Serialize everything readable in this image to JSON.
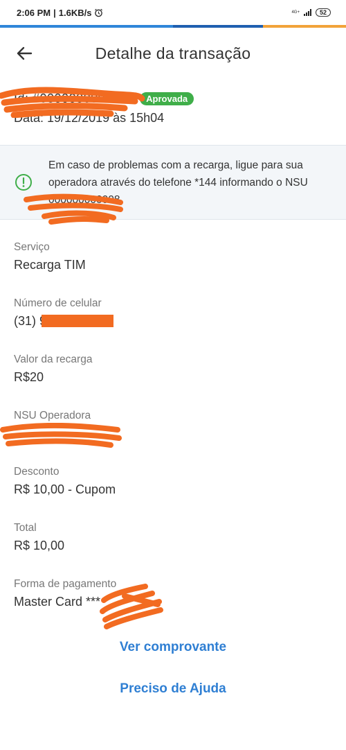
{
  "status_bar": {
    "time": "2:06 PM",
    "speed": "1.6KB/s",
    "alarm_icon": "alarm-clock-icon",
    "network_type": "4G+",
    "battery": "52"
  },
  "header": {
    "back_icon": "arrow-left-icon",
    "title": "Detalhe da transação"
  },
  "transaction": {
    "id": "Id: #0000000000702",
    "status": "Aprovada",
    "status_color": "#3fae49",
    "date": "Data: 19/12/2019 às 15h04"
  },
  "alert": {
    "icon": "exclamation-circle-icon",
    "icon_color": "#3fae49",
    "line1": "Em caso de problemas com a recarga, ligue para sua",
    "line2": "operadora através do telefone *144 informando o NSU",
    "line3": "000000000008"
  },
  "fields": [
    {
      "label": "Serviço",
      "value": "Recarga TIM"
    },
    {
      "label": "Número de celular",
      "value": "(31) 99"
    },
    {
      "label": "Valor da recarga",
      "value": "R$20"
    },
    {
      "label": "NSU Operadora",
      "value": ""
    },
    {
      "label": "Desconto",
      "value": "R$ 10,00 - Cupom"
    },
    {
      "label": "Total",
      "value": "R$ 10,00"
    },
    {
      "label": "Forma de pagamento",
      "value": "Master Card ***"
    }
  ],
  "actions": {
    "receipt": "Ver comprovante",
    "help": "Preciso de Ajuda"
  },
  "colors": {
    "link": "#2f7fd3",
    "redaction": "#f26b21"
  }
}
